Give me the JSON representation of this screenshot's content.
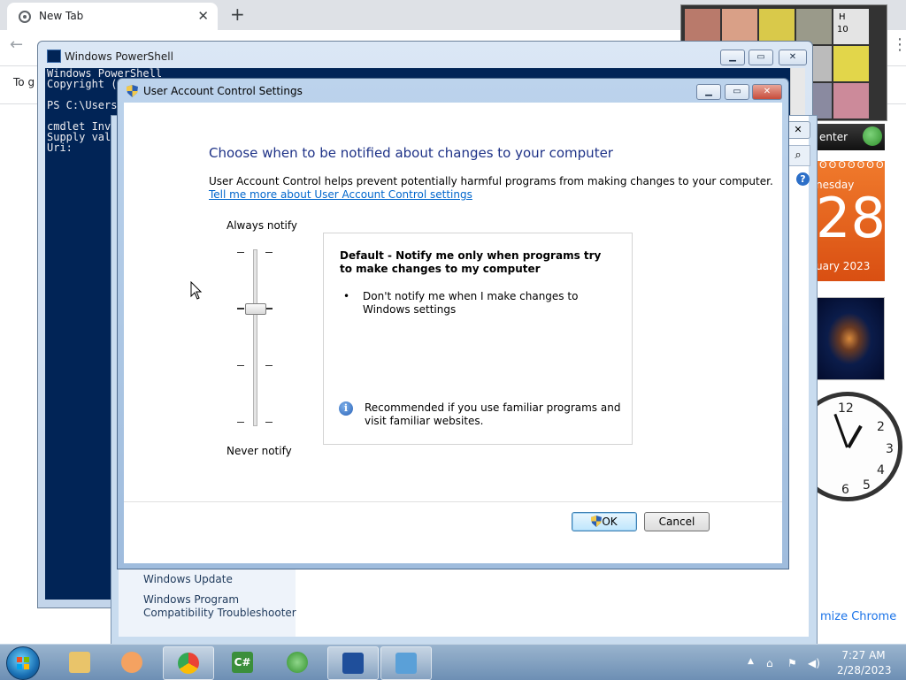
{
  "chrome": {
    "tab_title": "New Tab",
    "tab_close": "✕",
    "new_tab": "+",
    "back": "←",
    "menu": "⋮",
    "info_text": "To g",
    "customize": "mize Chrome"
  },
  "gadgets": {
    "strip_text": "enter",
    "calendar_day_name": "nesday",
    "calendar_day_num": "28",
    "calendar_month": "uary 2023",
    "clock_numbers": [
      "12",
      "2",
      "3",
      "4",
      "5",
      "6"
    ],
    "slideshow_caption_h": "H",
    "slideshow_caption_10": "10"
  },
  "control_panel": {
    "links": [
      "Windows Update",
      "Windows Program",
      "Compatibility Troubleshooter"
    ],
    "close": "✕",
    "search_icon": "⌕",
    "help": "?"
  },
  "powershell": {
    "title": "Windows PowerShell",
    "lines": [
      "Windows PowerShell",
      "Copyright (C",
      "",
      "PS C:\\Users\\",
      "",
      "cmdlet Invo",
      "Supply valu",
      "Uri:"
    ],
    "btn_min": "▁",
    "btn_max": "▭",
    "btn_close": "✕"
  },
  "uac": {
    "title": "User Account Control Settings",
    "heading": "Choose when to be notified about changes to your computer",
    "description": "User Account Control helps prevent potentially harmful programs from making changes to your computer.",
    "link": "Tell me more about User Account Control settings",
    "slider_top": "Always notify",
    "slider_bottom": "Never notify",
    "slider_level": 2,
    "slider_levels": 4,
    "info_title": "Default - Notify me only when programs try to make changes to my computer",
    "bullet": "•",
    "info_bullet": "Don't notify me when I make changes to Windows settings",
    "info_icon": "i",
    "recommendation": "Recommended if you use familiar programs and visit familiar websites.",
    "ok": "OK",
    "cancel": "Cancel",
    "btn_min": "▁",
    "btn_max": "▭",
    "btn_close": "✕"
  },
  "taskbar": {
    "items": [
      {
        "name": "explorer-taskbar-button",
        "color": "#e9c46a"
      },
      {
        "name": "media-player-taskbar-button",
        "color": "#f4a261"
      },
      {
        "name": "chrome-taskbar-button",
        "color": "#ea4335"
      },
      {
        "name": "csharp-taskbar-button",
        "color": "#3b8f3b"
      },
      {
        "name": "windows-taskbar-button",
        "color": "#47a447"
      },
      {
        "name": "powershell-taskbar-button",
        "color": "#1f4f9b"
      },
      {
        "name": "control-panel-taskbar-button",
        "color": "#5aa0d8"
      }
    ],
    "csharp_label": "C#",
    "time": "7:27 AM",
    "date": "2/28/2023",
    "tray_arrow": "▲"
  }
}
